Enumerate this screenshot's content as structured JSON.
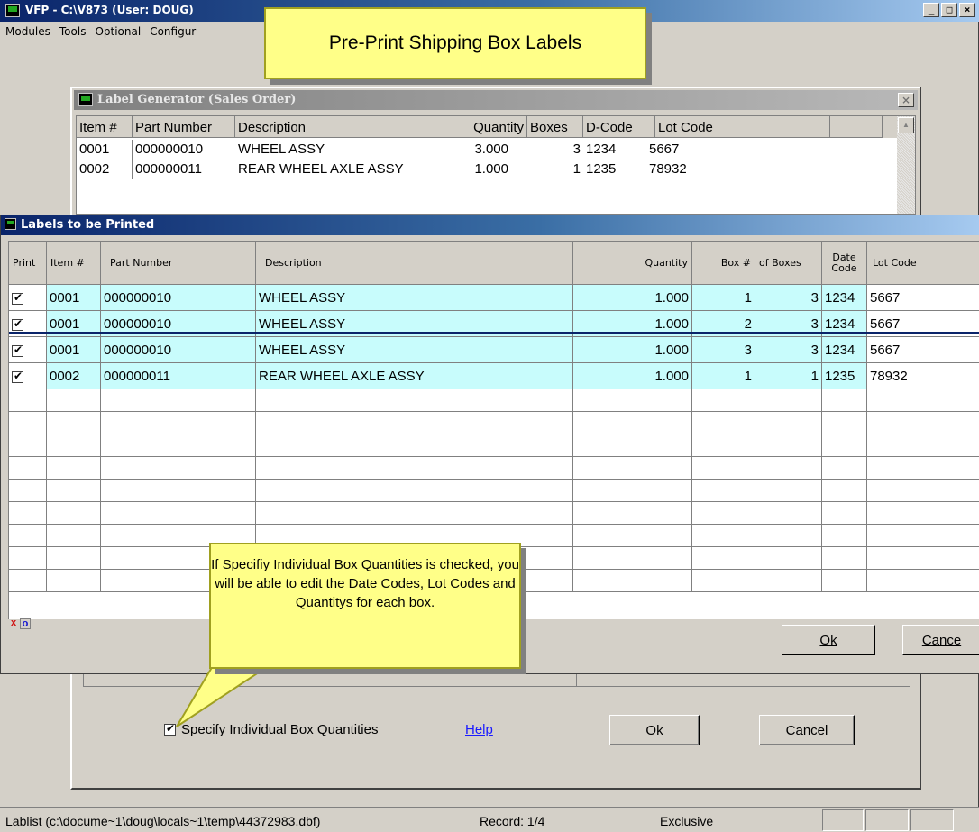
{
  "window": {
    "title": "VFP - C:\\V873 (User: DOUG)",
    "min": "_",
    "max": "□",
    "close": "×"
  },
  "menu": [
    "Modules",
    "Tools",
    "Optional",
    "Configur"
  ],
  "callout_title": "Pre-Print Shipping Box Labels",
  "label_generator": {
    "title": "Label Generator  (Sales Order)",
    "close": "×",
    "columns": [
      "Item #",
      "Part Number",
      "Description",
      "Quantity",
      "Boxes",
      "D-Code",
      "Lot Code"
    ],
    "rows": [
      [
        "0001",
        "000000010",
        "WHEEL ASSY",
        "3.000",
        "3",
        "1234",
        "5667"
      ],
      [
        "0002",
        "000000011",
        "REAR WHEEL AXLE ASSY",
        "1.000",
        "1",
        "1235",
        "78932"
      ]
    ],
    "specify_label": "Specify Individual Box Quantities",
    "specify_checked": true,
    "help_label": "Help",
    "ok_label": "Ok",
    "cancel_label": "Cancel"
  },
  "labels_window": {
    "title": "Labels to be Printed",
    "columns": [
      "Print",
      "Item #",
      "Part Number",
      "Description",
      "Quantity",
      "Box #",
      "of Boxes",
      "Date Code",
      "Lot Code"
    ],
    "rows": [
      {
        "print": true,
        "item": "0001",
        "part": "000000010",
        "desc": "WHEEL ASSY",
        "qty": "1.000",
        "box": "1",
        "of": "3",
        "dcode": "1234",
        "lot": "5667"
      },
      {
        "print": true,
        "item": "0001",
        "part": "000000010",
        "desc": "WHEEL ASSY",
        "qty": "1.000",
        "box": "2",
        "of": "3",
        "dcode": "1234",
        "lot": "5667"
      },
      {
        "print": true,
        "item": "0001",
        "part": "000000010",
        "desc": "WHEEL ASSY",
        "qty": "1.000",
        "box": "3",
        "of": "3",
        "dcode": "1234",
        "lot": "5667"
      },
      {
        "print": true,
        "item": "0002",
        "part": "000000011",
        "desc": "REAR WHEEL AXLE ASSY",
        "qty": "1.000",
        "box": "1",
        "of": "1",
        "dcode": "1235",
        "lot": "78932"
      }
    ],
    "ok_label": "Ok",
    "cancel_label": "Cance"
  },
  "callout_help": "If Specifiy Individual Box Quantities is checked, you will be able to edit the Date Codes, Lot Codes and Quantitys for each box.",
  "status": {
    "file": "Lablist (c:\\docume~1\\doug\\locals~1\\temp\\44372983.dbf)",
    "record": "Record: 1/4",
    "mode": "Exclusive"
  },
  "colors": {
    "title_active": "#0a246a",
    "row_highlight": "#c8fcfc",
    "callout": "#ffff88"
  }
}
